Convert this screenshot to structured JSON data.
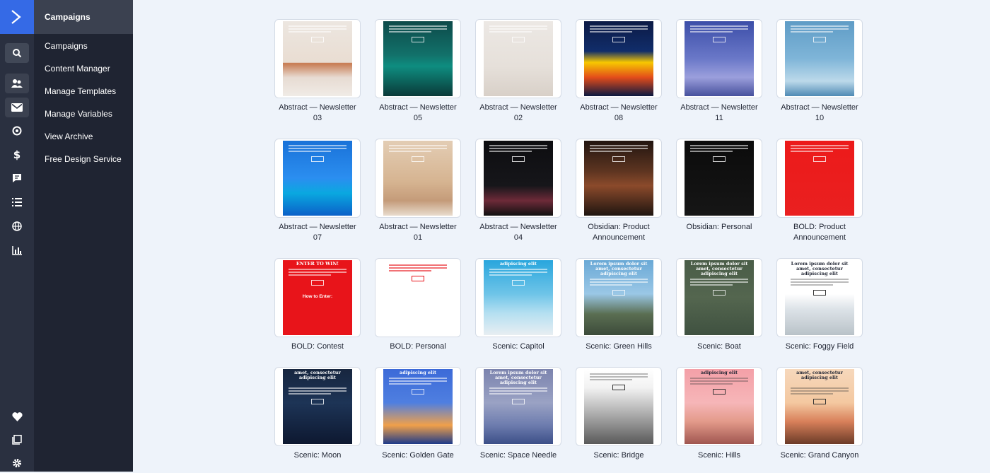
{
  "app": {
    "brand_color": "#356ae6"
  },
  "rail": {
    "top_icons": [
      "search-icon",
      "contacts-icon",
      "mail-icon",
      "target-icon",
      "dollar-icon",
      "conversations-icon",
      "lists-icon",
      "globe-icon",
      "reports-icon"
    ],
    "bottom_icons": [
      "heart-icon",
      "pages-icon",
      "gear-icon"
    ]
  },
  "panel": {
    "title": "Campaigns",
    "items": [
      "Campaigns",
      "Content Manager",
      "Manage Templates",
      "Manage Variables",
      "View Archive",
      "Free Design Service"
    ]
  },
  "templates": [
    {
      "label": "Abstract — Newsletter 03"
    },
    {
      "label": "Abstract — Newsletter 05"
    },
    {
      "label": "Abstract — Newsletter 02"
    },
    {
      "label": "Abstract — Newsletter 08"
    },
    {
      "label": "Abstract — Newsletter 11"
    },
    {
      "label": "Abstract — Newsletter 10"
    },
    {
      "label": "Abstract — Newsletter 07"
    },
    {
      "label": "Abstract — Newsletter 01"
    },
    {
      "label": "Abstract — Newsletter 04"
    },
    {
      "label": "Obsidian: Product Announcement"
    },
    {
      "label": "Obsidian: Personal"
    },
    {
      "label": "BOLD: Product Announcement"
    },
    {
      "label": "BOLD: Contest",
      "headline": "ENTER TO WIN!",
      "sub": "How to Enter:"
    },
    {
      "label": "BOLD: Personal"
    },
    {
      "label": "Scenic: Capitol",
      "headline": "adipiscing elit"
    },
    {
      "label": "Scenic: Green Hills",
      "headline": "Lorem ipsum dolor sit amet, consectetur adipiscing elit"
    },
    {
      "label": "Scenic: Boat",
      "headline": "Lorem ipsum dolor sit amet, consectetur adipiscing elit"
    },
    {
      "label": "Scenic: Foggy Field",
      "headline": "Lorem ipsum dolor sit amet, consectetur adipiscing elit"
    },
    {
      "label": "Scenic: Moon",
      "headline": "amet, consectetur adipiscing elit"
    },
    {
      "label": "Scenic: Golden Gate",
      "headline": "adipiscing elit"
    },
    {
      "label": "Scenic: Space Needle",
      "headline": "Lorem ipsum dolor sit amet, consectetur adipiscing elit"
    },
    {
      "label": "Scenic: Bridge"
    },
    {
      "label": "Scenic: Hills",
      "headline": "adipiscing elit"
    },
    {
      "label": "Scenic: Grand Canyon",
      "headline": "amet, consectetur adipiscing elit"
    }
  ]
}
